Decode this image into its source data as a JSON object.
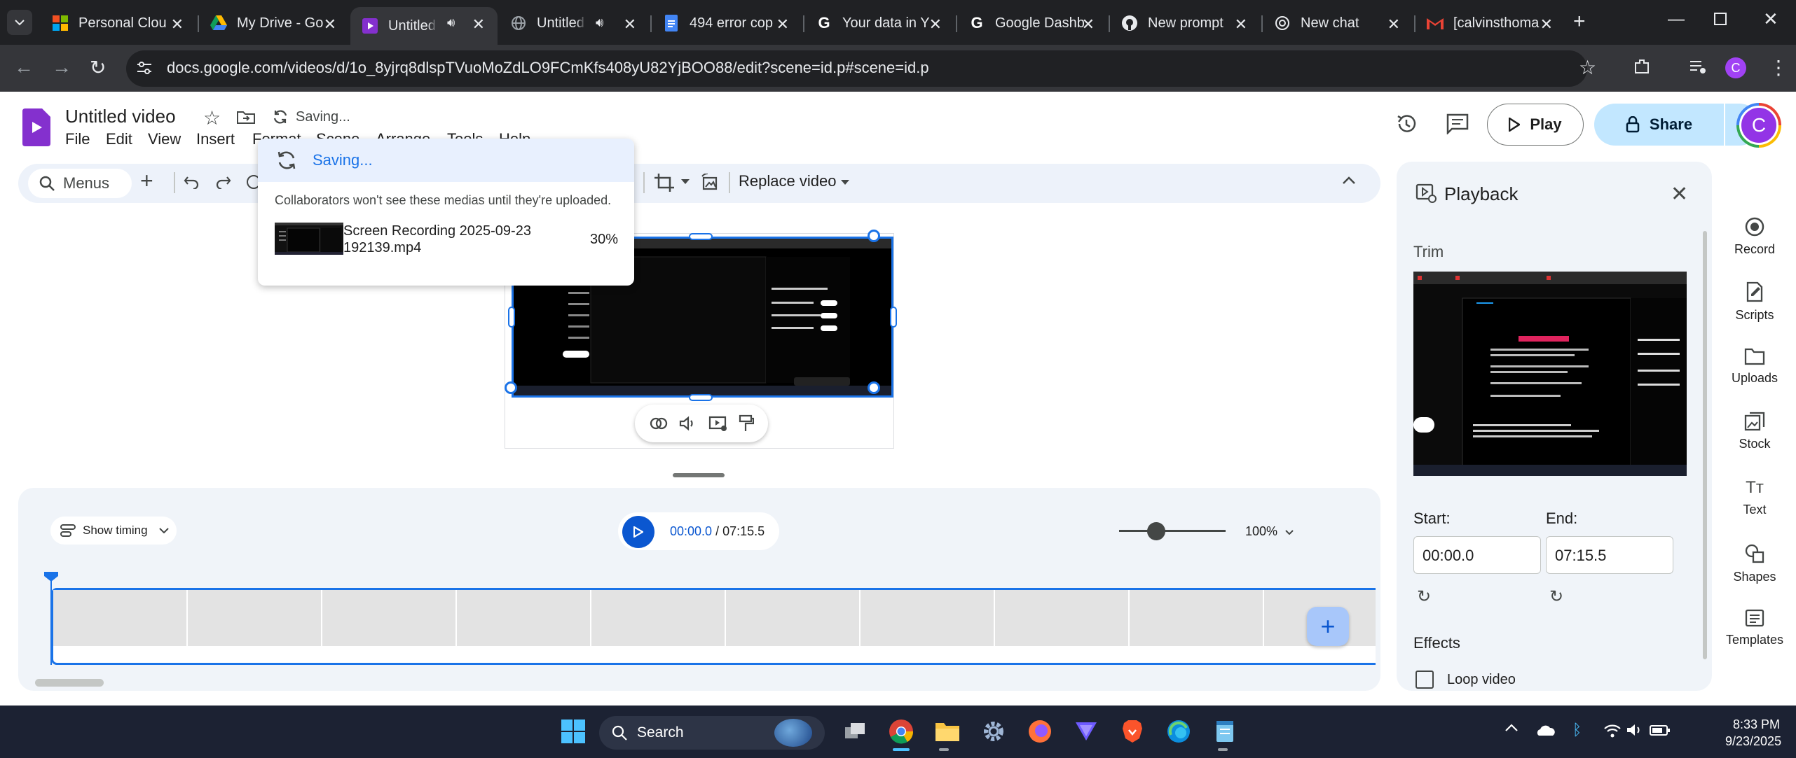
{
  "browser": {
    "tabs": [
      {
        "title": "Personal Clou",
        "icon": "microsoft-icon"
      },
      {
        "title": "My Drive - Go",
        "icon": "google-drive-icon"
      },
      {
        "title": "Untitled vi",
        "icon": "google-vids-icon",
        "active": true
      },
      {
        "title": "Untitled vi",
        "icon": "globe-icon"
      },
      {
        "title": "494 error cop",
        "icon": "google-docs-icon"
      },
      {
        "title": "Your data in Y",
        "icon": "google-icon"
      },
      {
        "title": "Google Dashb",
        "icon": "google-icon"
      },
      {
        "title": "New prompt",
        "icon": "github-icon"
      },
      {
        "title": "New chat",
        "icon": "chatgpt-icon"
      },
      {
        "title": "[calvinsthoma",
        "icon": "gmail-icon"
      }
    ],
    "url": "docs.google.com/videos/d/1o_8yjrq8dlspTVuoMoZdLO9FCmKfs408yU82YjBOO88/edit?scene=id.p#scene=id.p",
    "profile_initial": "C"
  },
  "app": {
    "title": "Untitled video",
    "save_status": "Saving...",
    "menu": [
      "File",
      "Edit",
      "View",
      "Insert",
      "Format",
      "Scene",
      "Arrange",
      "Tools",
      "Help"
    ],
    "play_label": "Play",
    "share_label": "Share",
    "user_initial": "C"
  },
  "toolbar": {
    "search_label": "Menus",
    "replace_video_label": "Replace video"
  },
  "popup": {
    "header": "Saving...",
    "note": "Collaborators won't see these medias until they're uploaded.",
    "file_line1": "Screen Recording 2025-09-23",
    "file_line2": "192139.mp4",
    "progress": "30%"
  },
  "timeline": {
    "show_timing_label": "Show timing",
    "current_time": "00:00.0",
    "total_time": " / 07:15.5",
    "zoom": "100%",
    "zoom_level_fraction": 0.35
  },
  "panel": {
    "title": "Playback",
    "trim_label": "Trim",
    "start_label": "Start:",
    "end_label": "End:",
    "start_value": "00:00.0",
    "end_value": "07:15.5",
    "effects_label": "Effects",
    "loop_label": "Loop video"
  },
  "rail": [
    "Record",
    "Scripts",
    "Uploads",
    "Stock",
    "Text",
    "Shapes",
    "Templates"
  ],
  "taskbar": {
    "search_label": "Search",
    "time": "8:33 PM",
    "date": "9/23/2025"
  },
  "colors": {
    "accent": "#1a73e8",
    "vids_purple": "#8430ce",
    "panel_bg": "#f0f4f9"
  }
}
